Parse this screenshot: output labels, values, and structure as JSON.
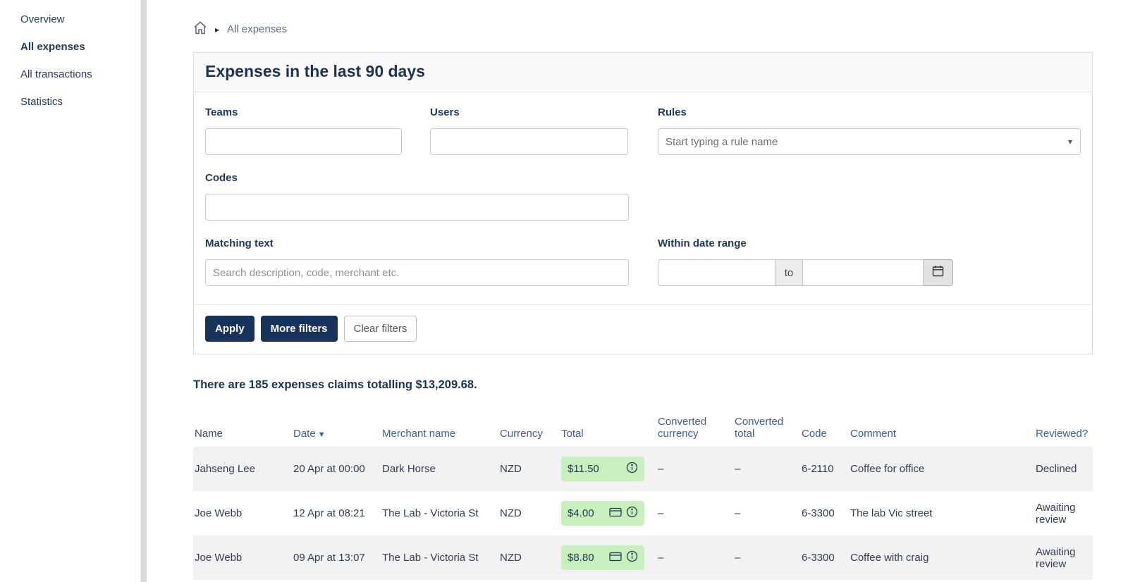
{
  "sidebar": {
    "items": [
      {
        "label": "Overview",
        "active": false
      },
      {
        "label": "All expenses",
        "active": true
      },
      {
        "label": "All transactions",
        "active": false
      },
      {
        "label": "Statistics",
        "active": false
      }
    ]
  },
  "breadcrumb": {
    "current": "All expenses"
  },
  "card": {
    "title": "Expenses in the last 90 days"
  },
  "filters": {
    "teams_label": "Teams",
    "users_label": "Users",
    "rules_label": "Rules",
    "rules_placeholder": "Start typing a rule name",
    "codes_label": "Codes",
    "matching_label": "Matching text",
    "matching_placeholder": "Search description, code, merchant etc.",
    "daterange_label": "Within date range",
    "daterange_to": "to"
  },
  "actions": {
    "apply": "Apply",
    "more_filters": "More filters",
    "clear_filters": "Clear filters"
  },
  "summary": {
    "text": "There are 185 expenses claims totalling $13,209.68."
  },
  "table": {
    "sort_indicator": "▼",
    "headers": {
      "name": "Name",
      "date": "Date",
      "merchant": "Merchant name",
      "currency": "Currency",
      "total": "Total",
      "converted_currency": "Converted currency",
      "converted_total": "Converted total",
      "code": "Code",
      "comment": "Comment",
      "reviewed": "Reviewed?"
    },
    "rows": [
      {
        "name": "Jahseng Lee",
        "date": "20 Apr at 00:00",
        "merchant": "Dark Horse",
        "currency": "NZD",
        "total": "$11.50",
        "converted_currency": "–",
        "converted_total": "–",
        "code": "6-2110",
        "comment": "Coffee for office",
        "reviewed": "Declined"
      },
      {
        "name": "Joe Webb",
        "date": "12 Apr at 08:21",
        "merchant": "The Lab - Victoria St",
        "currency": "NZD",
        "total": "$4.00",
        "converted_currency": "–",
        "converted_total": "–",
        "code": "6-3300",
        "comment": "The lab Vic street",
        "reviewed": "Awaiting review"
      },
      {
        "name": "Joe Webb",
        "date": "09 Apr at 13:07",
        "merchant": "The Lab - Victoria St",
        "currency": "NZD",
        "total": "$8.80",
        "converted_currency": "–",
        "converted_total": "–",
        "code": "6-3300",
        "comment": "Coffee with craig",
        "reviewed": "Awaiting review"
      }
    ]
  },
  "colors": {
    "accent_navy": "#17335b",
    "link_blue": "#3d5c9e",
    "badge_green": "#c8efbd",
    "row_stripe": "#f2f2f2"
  }
}
